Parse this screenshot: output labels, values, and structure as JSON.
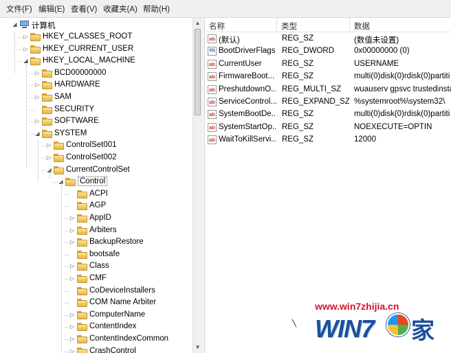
{
  "menu": [
    "文件(F)",
    "编辑(E)",
    "查看(V)",
    "收藏夹(A)",
    "帮助(H)"
  ],
  "tree": {
    "root": "计算机",
    "nodes": [
      {
        "label": "HKEY_CLASSES_ROOT",
        "level": 1,
        "exp": "▷"
      },
      {
        "label": "HKEY_CURRENT_USER",
        "level": 1,
        "exp": "▷"
      },
      {
        "label": "HKEY_LOCAL_MACHINE",
        "level": 1,
        "exp": "◢"
      },
      {
        "label": "BCD00000000",
        "level": 2,
        "exp": "▷"
      },
      {
        "label": "HARDWARE",
        "level": 2,
        "exp": "▷"
      },
      {
        "label": "SAM",
        "level": 2,
        "exp": "▷"
      },
      {
        "label": "SECURITY",
        "level": 2,
        "exp": ""
      },
      {
        "label": "SOFTWARE",
        "level": 2,
        "exp": "▷"
      },
      {
        "label": "SYSTEM",
        "level": 2,
        "exp": "◢"
      },
      {
        "label": "ControlSet001",
        "level": 3,
        "exp": "▷"
      },
      {
        "label": "ControlSet002",
        "level": 3,
        "exp": "▷"
      },
      {
        "label": "CurrentControlSet",
        "level": 3,
        "exp": "◢"
      },
      {
        "label": "Control",
        "level": 4,
        "exp": "◢",
        "selected": true
      },
      {
        "label": "ACPI",
        "level": 5,
        "exp": ""
      },
      {
        "label": "AGP",
        "level": 5,
        "exp": ""
      },
      {
        "label": "AppID",
        "level": 5,
        "exp": "▷"
      },
      {
        "label": "Arbiters",
        "level": 5,
        "exp": "▷"
      },
      {
        "label": "BackupRestore",
        "level": 5,
        "exp": "▷"
      },
      {
        "label": "bootsafe",
        "level": 5,
        "exp": ""
      },
      {
        "label": "Class",
        "level": 5,
        "exp": "▷"
      },
      {
        "label": "CMF",
        "level": 5,
        "exp": "▷"
      },
      {
        "label": "CoDeviceInstallers",
        "level": 5,
        "exp": ""
      },
      {
        "label": "COM Name Arbiter",
        "level": 5,
        "exp": ""
      },
      {
        "label": "ComputerName",
        "level": 5,
        "exp": "▷"
      },
      {
        "label": "ContentIndex",
        "level": 5,
        "exp": "▷"
      },
      {
        "label": "ContentIndexCommon",
        "level": 5,
        "exp": "▷"
      },
      {
        "label": "CrashControl",
        "level": 5,
        "exp": "▷"
      }
    ]
  },
  "list": {
    "headers": [
      "名称",
      "类型",
      "数据"
    ],
    "rows": [
      {
        "icon": "ab",
        "name": "(默认)",
        "type": "REG_SZ",
        "data": "(数值未设置)"
      },
      {
        "icon": "bin",
        "name": "BootDriverFlags",
        "type": "REG_DWORD",
        "data": "0x00000000 (0)"
      },
      {
        "icon": "ab",
        "name": "CurrentUser",
        "type": "REG_SZ",
        "data": "USERNAME"
      },
      {
        "icon": "ab",
        "name": "FirmwareBoot...",
        "type": "REG_SZ",
        "data": "multi(0)disk(0)rdisk(0)partiti"
      },
      {
        "icon": "ab",
        "name": "PreshutdownO...",
        "type": "REG_MULTI_SZ",
        "data": "wuauserv gpsvc trustedinsta"
      },
      {
        "icon": "ab",
        "name": "ServiceControl...",
        "type": "REG_EXPAND_SZ",
        "data": "%systemroot%\\system32\\"
      },
      {
        "icon": "ab",
        "name": "SystemBootDe...",
        "type": "REG_SZ",
        "data": "multi(0)disk(0)rdisk(0)partiti"
      },
      {
        "icon": "ab",
        "name": "SystemStartOp...",
        "type": "REG_SZ",
        "data": " NOEXECUTE=OPTIN"
      },
      {
        "icon": "ab",
        "name": "WaitToKillServi...",
        "type": "REG_SZ",
        "data": "12000"
      }
    ]
  },
  "watermark": {
    "url": "www.win7zhijia.cn",
    "logo": "WIN7",
    "han": "家"
  }
}
